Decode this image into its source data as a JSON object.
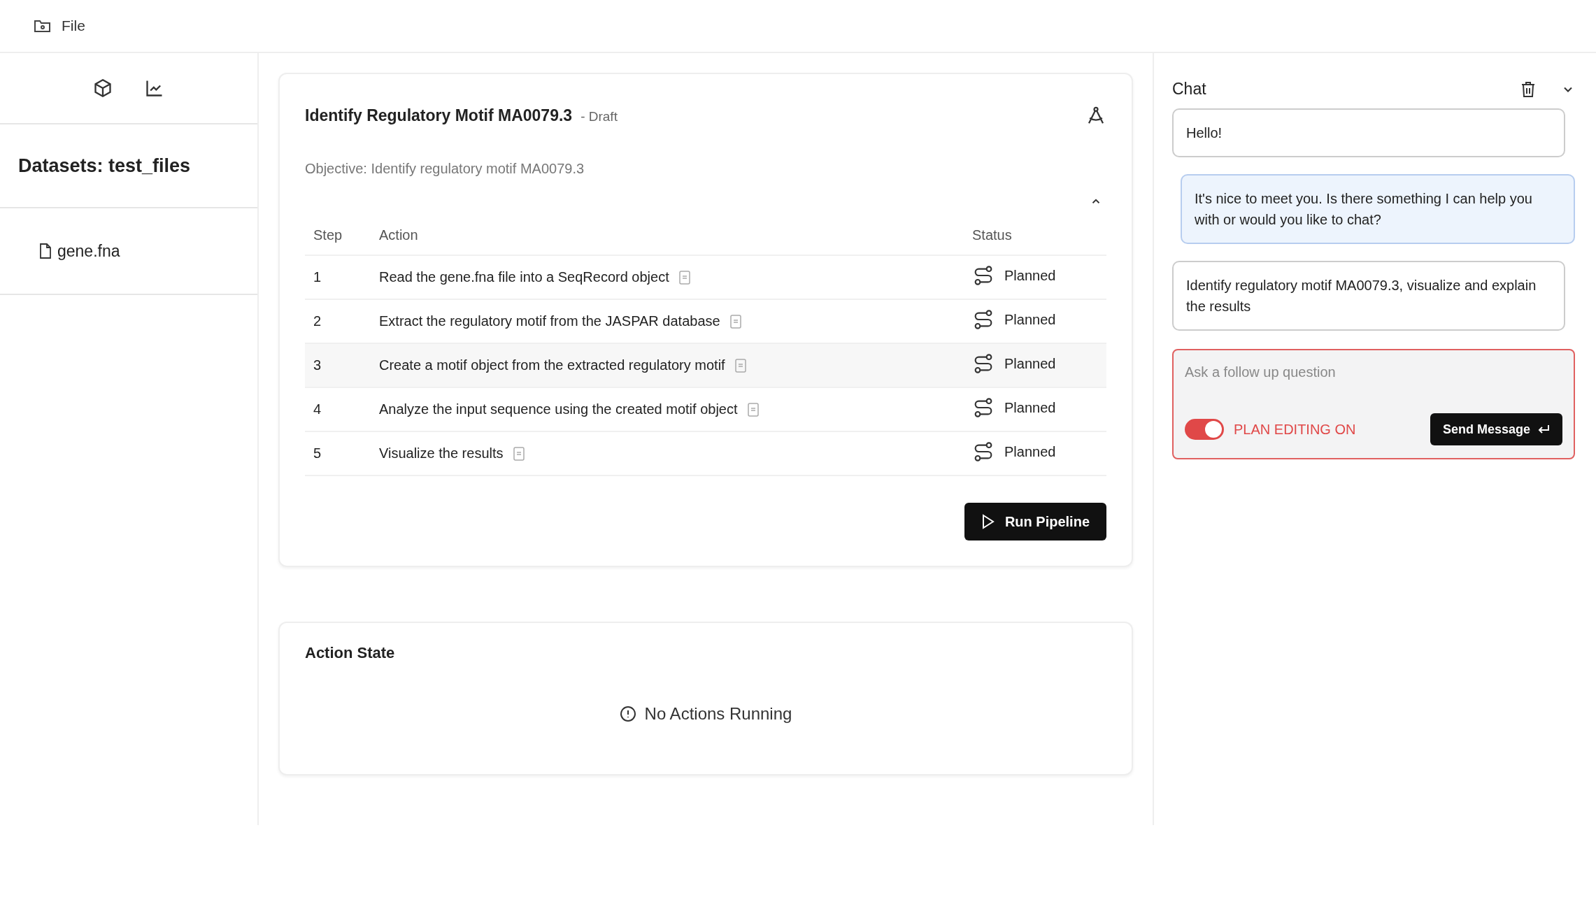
{
  "menu_bar": {
    "file_menu": "File"
  },
  "sidebar": {
    "heading": "Datasets: test_files",
    "files": [
      "gene.fna"
    ]
  },
  "plan": {
    "title": "Identify Regulatory Motif MA0079.3",
    "badge": "- Draft",
    "objective": "Objective: Identify regulatory motif MA0079.3",
    "expanded": true,
    "table": {
      "columns": [
        "Step",
        "Action",
        "Status"
      ],
      "rows": [
        {
          "step": "1",
          "action": "Read the gene.fna file into a SeqRecord object",
          "status": "Planned",
          "highlighted": false
        },
        {
          "step": "2",
          "action": "Extract the regulatory motif from the JASPAR database",
          "status": "Planned",
          "highlighted": false
        },
        {
          "step": "3",
          "action": "Create a motif object from the extracted regulatory motif",
          "status": "Planned",
          "highlighted": true
        },
        {
          "step": "4",
          "action": "Analyze the input sequence using the created motif object",
          "status": "Planned",
          "highlighted": false
        },
        {
          "step": "5",
          "action": "Visualize the results",
          "status": "Planned",
          "highlighted": false
        }
      ]
    },
    "run_button": "Run Pipeline"
  },
  "action_state": {
    "title": "Action State",
    "empty_message": "No Actions Running"
  },
  "chat": {
    "title": "Chat",
    "messages": [
      {
        "kind": "user",
        "text": "Hello!"
      },
      {
        "kind": "assistant",
        "text": "It's nice to meet you. Is there something I can help you with or would you like to chat?"
      },
      {
        "kind": "user",
        "text": "Identify regulatory motif MA0079.3, visualize and explain the results"
      }
    ],
    "input": {
      "placeholder": "Ask a follow up question"
    },
    "plan_editing": {
      "label": "PLAN EDITING ON",
      "on": true
    },
    "send_button": "Send Message"
  }
}
